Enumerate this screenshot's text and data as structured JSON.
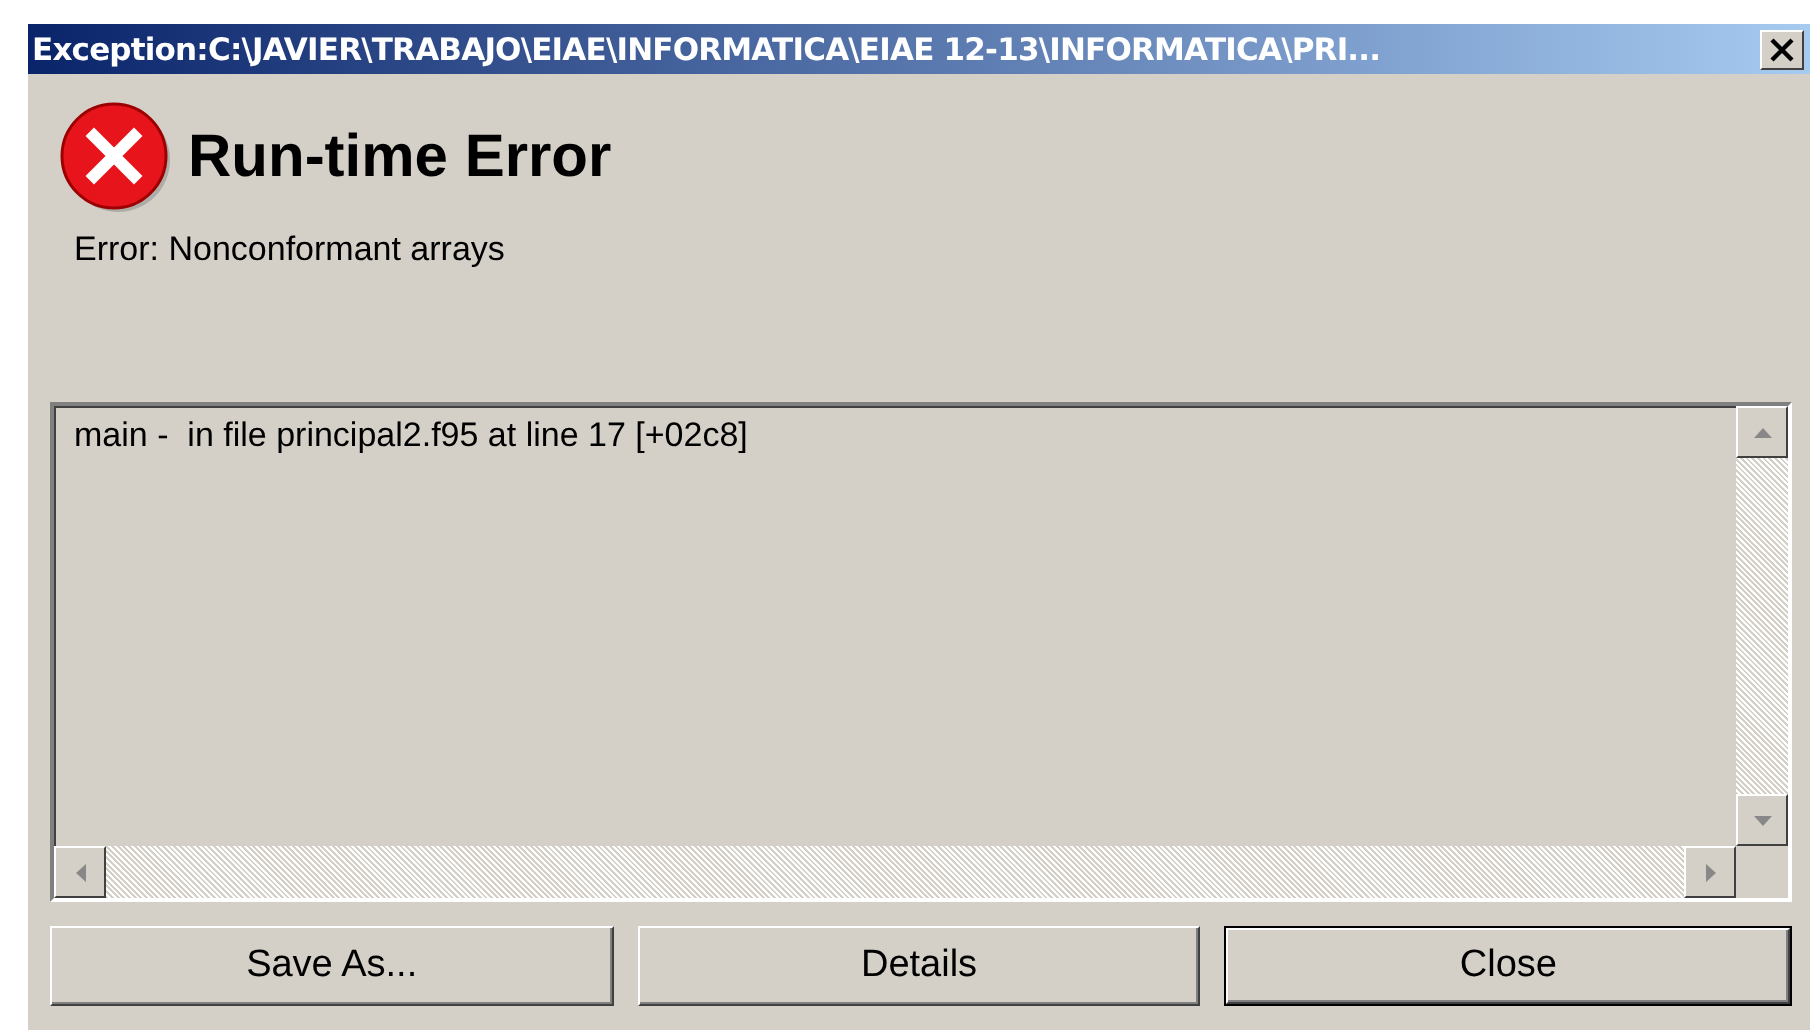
{
  "window": {
    "title": "Exception:C:\\JAVIER\\TRABAJO\\EIAE\\INFORMATICA\\EIAE 12-13\\INFORMATICA\\PRI..."
  },
  "heading": "Run-time Error",
  "message": "Error: Nonconformant arrays",
  "trace": [
    "main -  in file principal2.f95 at line 17 [+02c8]"
  ],
  "buttons": [
    {
      "label": "Save As...",
      "default": false
    },
    {
      "label": "Details",
      "default": false
    },
    {
      "label": "Close",
      "default": true
    }
  ]
}
